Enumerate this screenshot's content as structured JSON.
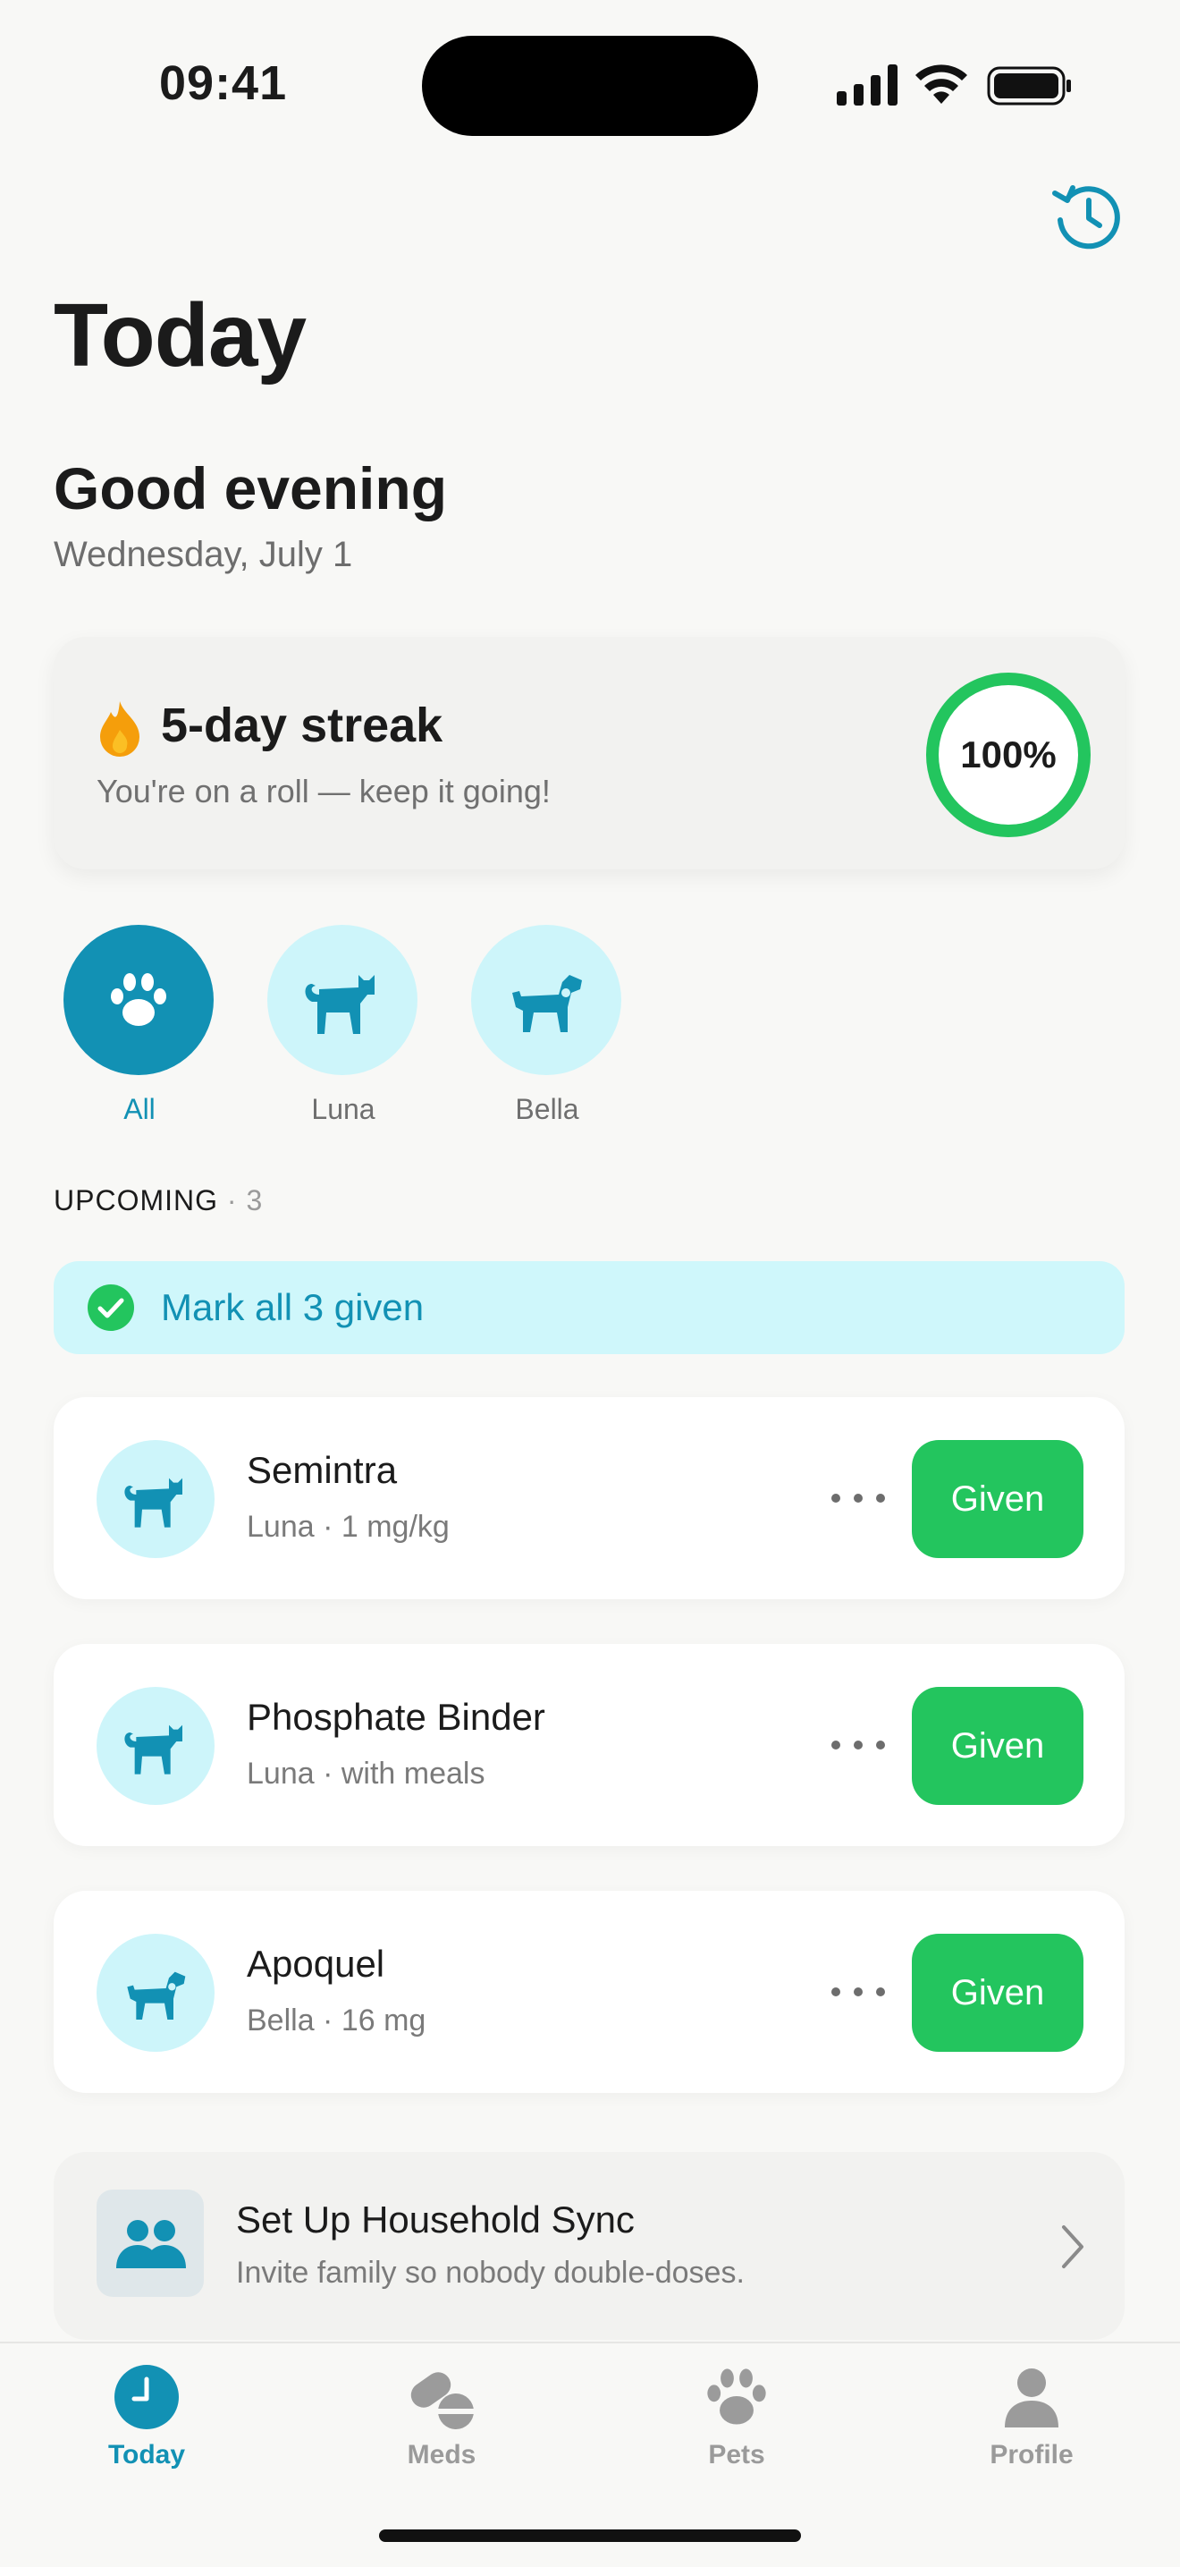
{
  "status_bar": {
    "time": "09:41"
  },
  "header": {
    "title": "Today",
    "history_icon": "history-clock-icon"
  },
  "greeting": {
    "title": "Good evening",
    "date": "Wednesday, July 1"
  },
  "streak": {
    "title": "5-day streak",
    "subtitle": "You're on a roll — keep it going!",
    "progress_label": "100%",
    "progress_fraction": 1.0,
    "icon": "flame-icon"
  },
  "pets": [
    {
      "label": "All",
      "icon": "paw-icon",
      "active": true
    },
    {
      "label": "Luna",
      "icon": "cat-icon",
      "active": false
    },
    {
      "label": "Bella",
      "icon": "dog-icon",
      "active": false
    }
  ],
  "upcoming": {
    "label": "UPCOMING",
    "separator": "·",
    "count": "3"
  },
  "mark_all": {
    "label": "Mark all 3 given"
  },
  "meds": [
    {
      "name": "Semintra",
      "detail": "Luna · 1 mg/kg",
      "pet_icon": "cat-icon",
      "action": "Given"
    },
    {
      "name": "Phosphate Binder",
      "detail": "Luna · with meals",
      "pet_icon": "cat-icon",
      "action": "Given"
    },
    {
      "name": "Apoquel",
      "detail": "Bella · 16 mg",
      "pet_icon": "dog-icon",
      "action": "Given"
    }
  ],
  "household": {
    "title": "Set Up Household Sync",
    "subtitle": "Invite family so nobody double-doses."
  },
  "tabs": [
    {
      "label": "Today",
      "icon": "clock-icon",
      "active": true
    },
    {
      "label": "Meds",
      "icon": "pill-icon",
      "active": false
    },
    {
      "label": "Pets",
      "icon": "paw-icon",
      "active": false
    },
    {
      "label": "Profile",
      "icon": "person-icon",
      "active": false
    }
  ],
  "colors": {
    "accent": "#1291b4",
    "accent_light": "#cdf5fa",
    "success": "#23c55e",
    "flame": "#f59e0b",
    "background": "#f8f8f6"
  }
}
